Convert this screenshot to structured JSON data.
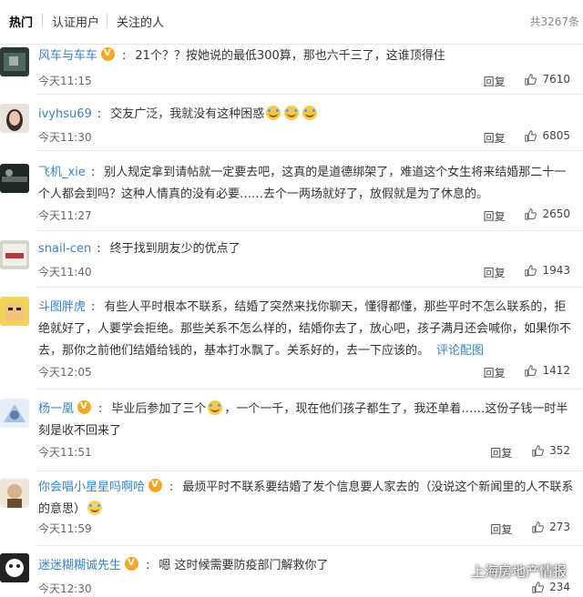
{
  "tabs": {
    "hot": "热门",
    "verified": "认证用户",
    "following": "关注的人",
    "total": "共3267条"
  },
  "labels": {
    "reply": "回复",
    "link_pic": "评论配图"
  },
  "comments": [
    {
      "user": "风车与车车",
      "verified": true,
      "text": "21个？？按她说的最低300算，那也六千三了，这谁顶得住",
      "time": "今天11:15",
      "likes": "7610"
    },
    {
      "user": "ivyhsu69",
      "verified": false,
      "text": "交友广泛，我就没有这种困惑",
      "time": "今天11:30",
      "likes": "6805"
    },
    {
      "user": "飞机_xie",
      "verified": false,
      "text": "别人规定拿到请帖就一定要去吧，这真的是道德绑架了，难道这个女生将来结婚那二十一个人都会到吗？这种人情真的没有必要……去个一两场就好了，放假就是为了休息的。",
      "time": "今天11:27",
      "likes": "2650"
    },
    {
      "user": "snail-cen",
      "verified": false,
      "text": "终于找到朋友少的优点了",
      "time": "今天11:40",
      "likes": "1943"
    },
    {
      "user": "斗图胖虎",
      "verified": false,
      "text": "有些人平时根本不联系，结婚了突然来找你聊天，懂得都懂，那些平时不怎么联系的，拒绝就好了，人要学会拒绝。那些关系不怎么样的，结婚你去了，放心吧，孩子满月还会喊你，如果你不去，那你之前他们结婚给钱的，基本打水飘了。关系好的，去一下应该的。",
      "time": "今天12:05",
      "likes": "1412"
    },
    {
      "user": "杨一凰",
      "verified": true,
      "text": "毕业后参加了三个",
      "text2": "，一个一千，现在他们孩子都生了，我还单着……这份子钱一时半刻是收不回来了",
      "time": "今天11:51",
      "likes": "352"
    },
    {
      "user": "你会唱小星星吗啊哈",
      "verified": true,
      "text": "最烦平时不联系要结婚了发个信息要人家去的（没说这个新闻里的人不联系的意思）",
      "time": "今天11:59",
      "likes": "273"
    },
    {
      "user": "迷迷糊糊诚先生",
      "verified": true,
      "text": "嗯 这时候需要防疫部门解救你了",
      "time": "今天12:30",
      "likes": "234"
    }
  ],
  "watermark": "上海房地产情报",
  "colors": {
    "link": "#3b83c5",
    "badge": "#f5a623"
  }
}
